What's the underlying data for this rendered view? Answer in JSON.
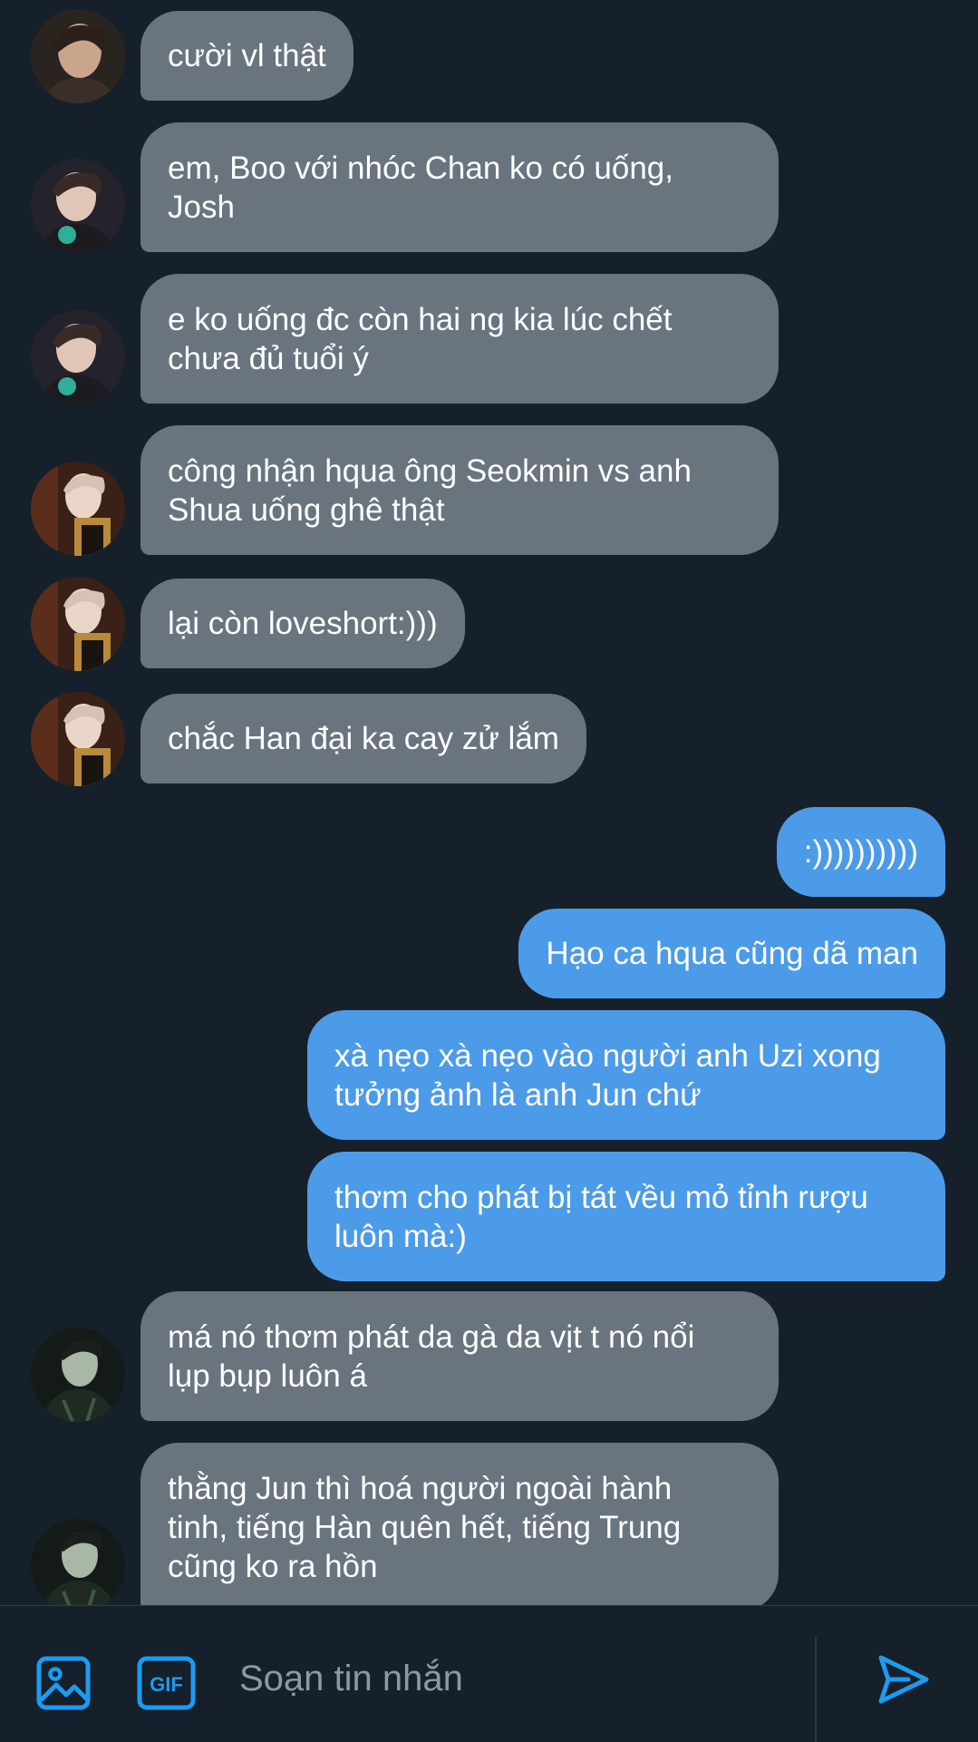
{
  "messages": [
    {
      "side": "in",
      "text": "cười vl thật",
      "avatar": "avatar-1"
    },
    {
      "side": "in",
      "lines": [
        "em, Boo với nhóc Chan ko có uống,",
        "Josh"
      ],
      "avatar": "avatar-2"
    },
    {
      "side": "in",
      "lines": [
        "e ko uống đc còn hai ng kia lúc chết",
        "chưa đủ tuổi ý"
      ],
      "avatar": "avatar-2"
    },
    {
      "side": "in",
      "lines": [
        "công nhận hqua ông Seokmin vs anh",
        "Shua uống ghê thật"
      ],
      "avatar": "avatar-3"
    },
    {
      "side": "in",
      "text": "lại còn loveshort:)))",
      "avatar": "avatar-3"
    },
    {
      "side": "in",
      "text": "chắc Han đại ka cay zử lắm",
      "avatar": "avatar-3"
    },
    {
      "side": "out",
      "text": ":))))))))))"
    },
    {
      "side": "out",
      "text": "Hạo ca hqua cũng dã man"
    },
    {
      "side": "out",
      "lines": [
        "xà nẹo xà nẹo vào người anh Uzi xong",
        "tưởng ảnh là anh Jun chứ"
      ]
    },
    {
      "side": "out",
      "lines": [
        "thơm cho phát bị tát vều mỏ tỉnh rượu",
        "luôn mà:)"
      ]
    },
    {
      "side": "in",
      "lines": [
        "má nó thơm phát da gà da vịt t nó nổi",
        "lụp bụp luôn á"
      ],
      "avatar": "avatar-4"
    },
    {
      "side": "in",
      "lines": [
        "thằng Jun thì hoá người ngoài hành",
        "tinh, tiếng Hàn quên hết, tiếng Trung",
        "cũng ko ra hồn"
      ],
      "avatar": "avatar-4"
    }
  ],
  "composer": {
    "placeholder": "Soạn tin nhắn",
    "gif_label": "GIF",
    "icons": [
      "image-icon",
      "gif-icon",
      "send-icon"
    ]
  },
  "colors": {
    "background": "#15202b",
    "incoming_bubble": "#69747e",
    "outgoing_bubble": "#4c9be8",
    "accent": "#1d9bf0"
  }
}
